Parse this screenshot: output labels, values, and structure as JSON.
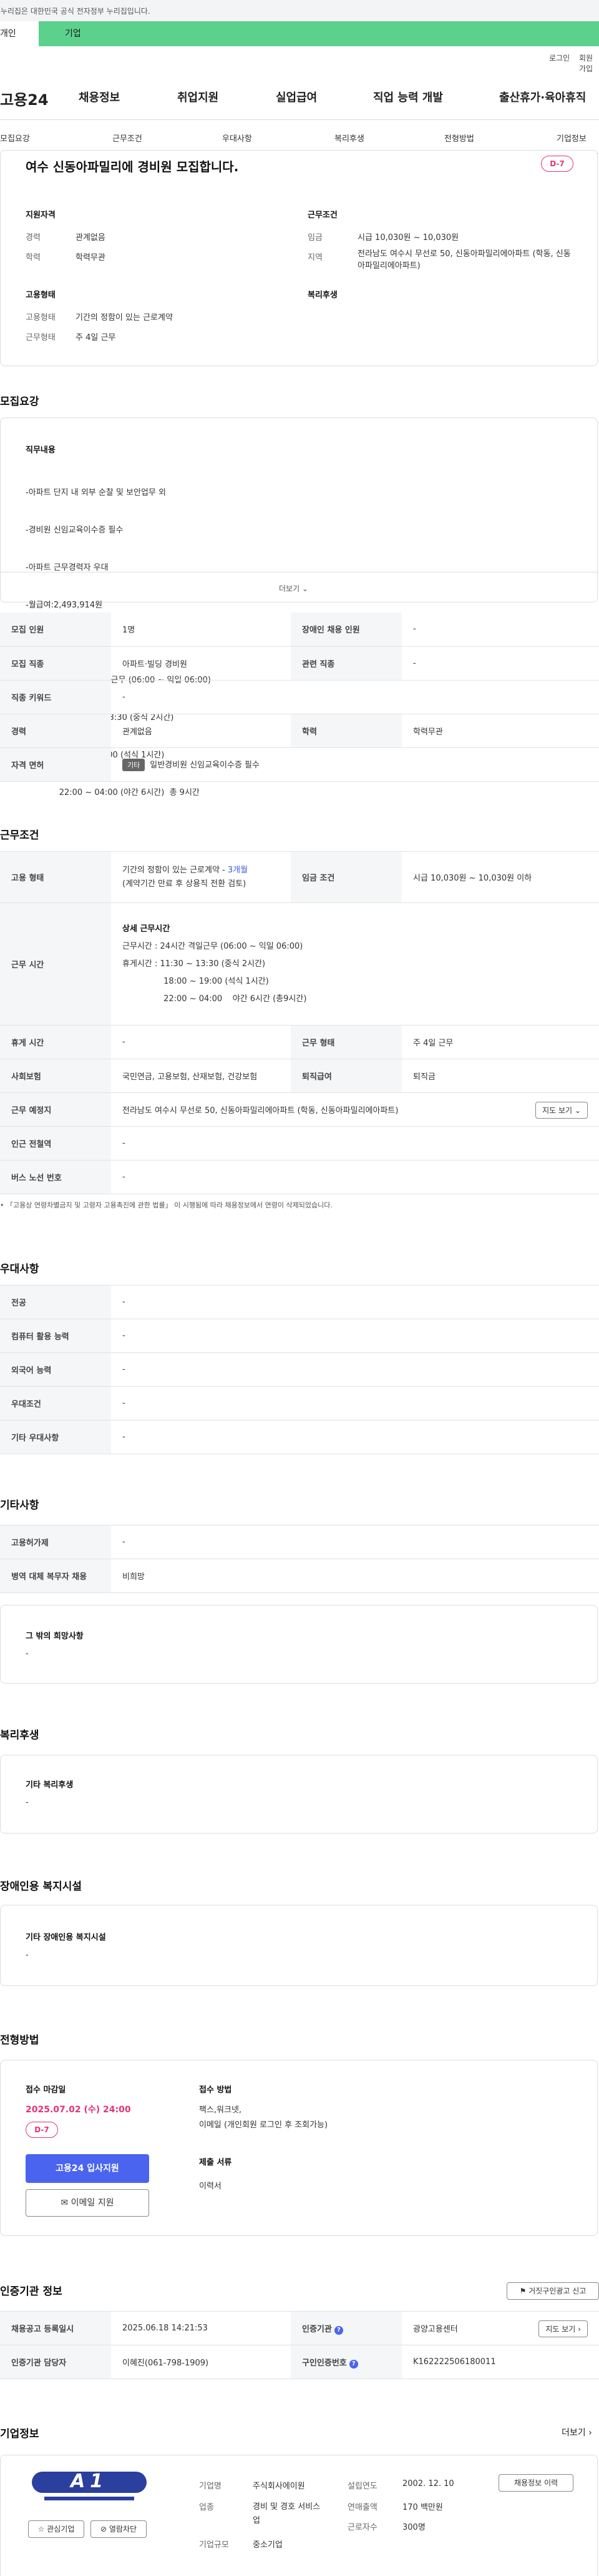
{
  "topbar": {
    "notice": "이 누리집은 대한민국 공식 전자정부 누리집입니다."
  },
  "user_tabs": {
    "personal": "개인",
    "company": "기업"
  },
  "util": {
    "login": "로그인",
    "join": "회원가입"
  },
  "gnb": {
    "logo": "고용24",
    "menus": [
      "채용정보",
      "취업지원",
      "실업급여",
      "직업 능력 개발",
      "출산휴가·육아휴직"
    ]
  },
  "subnav": [
    "모집요강",
    "근무조건",
    "우대사항",
    "복리후생",
    "전형방법",
    "기업정보"
  ],
  "summary": {
    "title": "여수 신동아파밀리에 경비원 모집합니다.",
    "dday": "D-7",
    "qual_title": "지원자격",
    "career_lbl": "경력",
    "career": "관계없음",
    "edu_lbl": "학력",
    "edu": "학력무관",
    "cond_title": "근무조건",
    "wage_lbl": "임금",
    "wage": "시급 10,030원 ~ 10,030원",
    "region_lbl": "지역",
    "region": "전라남도 여수시 무선로 50, 신동아파밀리에아파트 (학동, 신동아파밀리에아파트)",
    "emp_title": "고용형태",
    "emptype_lbl": "고용형태",
    "emptype": "기간의 정함이 있는 근로계약",
    "worktype_lbl": "근무형태",
    "worktype": "주 4일 근무",
    "welfare_title": "복리후생"
  },
  "recruit": {
    "heading": "모집요강",
    "duty_title": "직무내용",
    "duty_lines": [
      "-아파트 단지 내 외부 순찰 및 보안업무 외",
      "-경비원 신임교육이수증 필수",
      "-아파트 근무경력자 우대",
      "-월급여:2,493,914원",
      "",
      "•근무시간 : 24시간 격일근무 (06:00 ~ 익일 06:00)",
      "  휴게시간 : 11:30 ~ 13:30 (중식 2시간)",
      "             18:00 ~ 19:00 (석식 1시간)",
      "             22:00 ~ 04:00 (야간 6시간)  총 9시간"
    ],
    "more": "더보기",
    "rows": [
      [
        "모집 인원",
        "1명",
        "장애인 채용 인원",
        "-"
      ],
      [
        "모집 직종",
        "아파트·빌딩 경비원",
        "관련 직종",
        "-"
      ],
      [
        "직종 키워드",
        "-",
        "",
        ""
      ],
      [
        "경력",
        "관계없음",
        "학력",
        "학력무관"
      ],
      [
        "자격 면허",
        "",
        "",
        ""
      ]
    ],
    "license_badge": "기타",
    "license": "일반경비원 신임교육이수증 필수"
  },
  "conditions": {
    "heading": "근무조건",
    "emptype_lbl": "고용 형태",
    "emptype": "기간의 정함이 있는 근로계약 -",
    "emptype_period": "3개월",
    "emptype_note": "(계약기간 만료 후 상용직 전환 검토)",
    "wage_lbl": "임금 조건",
    "wage": "시급 10,030원 ~ 10,030원 이하",
    "hours_lbl": "근무 시간",
    "hours_title": "상세 근무시간",
    "hours_lines": [
      "근무시간 : 24시간 격일근무 (06:00 ~ 익일 06:00)",
      "휴게시간 : 11:30 ~ 13:30 (중식 2시간)",
      "                18:00 ~ 19:00 (석식 1시간)",
      "                22:00 ~ 04:00    야간 6시간 (총9시간)"
    ],
    "rest_lbl": "휴게 시간",
    "rest": "-",
    "worktype_lbl": "근무 형태",
    "worktype": "주 4일 근무",
    "insurance_lbl": "사회보험",
    "insurance": "국민연금, 고용보험, 산재보험, 건강보험",
    "severance_lbl": "퇴직급여",
    "severance": "퇴직금",
    "place_lbl": "근무 예정지",
    "place": "전라남도 여수시 무선로 50, 신동아파밀리에아파트 (학동, 신동아파밀리에아파트)",
    "map": "지도 보기",
    "subway_lbl": "인근 전철역",
    "subway": "-",
    "bus_lbl": "버스 노선 번호",
    "bus": "-",
    "footnote": "「고용상 연령차별금지 및 고령자 고용촉진에 관한 법률」 이 시행됨에 따라 채용정보에서 연령이 삭제되었습니다."
  },
  "preferences": {
    "heading": "우대사항",
    "rows": [
      [
        "전공",
        "-"
      ],
      [
        "컴퓨터 활용 능력",
        "-"
      ],
      [
        "외국어 능력",
        "-"
      ],
      [
        "우대조건",
        "-"
      ],
      [
        "기타 우대사항",
        "-"
      ]
    ]
  },
  "etc": {
    "heading": "기타사항",
    "rows": [
      [
        "고용허가제",
        "-"
      ],
      [
        "병역 대체 복무자 채용",
        "비희망"
      ]
    ],
    "hope_title": "그 밖의 희망사항",
    "hope": "-"
  },
  "welfare": {
    "heading": "복리후생",
    "box_title": "기타 복리후생",
    "box_val": "-"
  },
  "disability": {
    "heading": "장애인용 복지시설",
    "box_title": "기타 장애인용 복지시설",
    "box_val": "-"
  },
  "process": {
    "heading": "전형방법",
    "deadline_title": "접수 마감일",
    "deadline": "2025.07.02 (수) 24:00",
    "dday": "D-7",
    "apply_btn": "고용24 입사지원",
    "email_btn": "이메일 지원",
    "method_title": "접수 방법",
    "method": "팩스,워크넷,",
    "method2": "이메일 (개인회원 로그인 후 조회가능)",
    "docs_title": "제출 서류",
    "docs": "이력서"
  },
  "cert": {
    "heading": "인증기관 정보",
    "report": "거짓구인광고 신고",
    "reg_lbl": "채용공고 등록일시",
    "reg": "2025.06.18 14:21:53",
    "agency_lbl": "인증기관",
    "agency": "광양고용센터",
    "map": "지도 보기",
    "manager_lbl": "인증기관 담당자",
    "manager": "이혜진(061-798-1909)",
    "num_lbl": "구인인증번호",
    "num": "K162222506180011"
  },
  "company": {
    "heading": "기업정보",
    "more": "더보기",
    "logo_text": "A1",
    "fav": "관심기업",
    "block": "열람차단",
    "name_lbl": "기업명",
    "name": "주식회사에이원",
    "found_lbl": "설립연도",
    "found": "2002. 12. 10",
    "industry_lbl": "업종",
    "industry": "경비 및 경호 서비스업",
    "sales_lbl": "연매출액",
    "sales": "170 백만원",
    "size_lbl": "기업규모",
    "size": "중소기업",
    "emp_lbl": "근로자수",
    "emp": "300명",
    "jobs_btn": "채용정보 이력"
  }
}
